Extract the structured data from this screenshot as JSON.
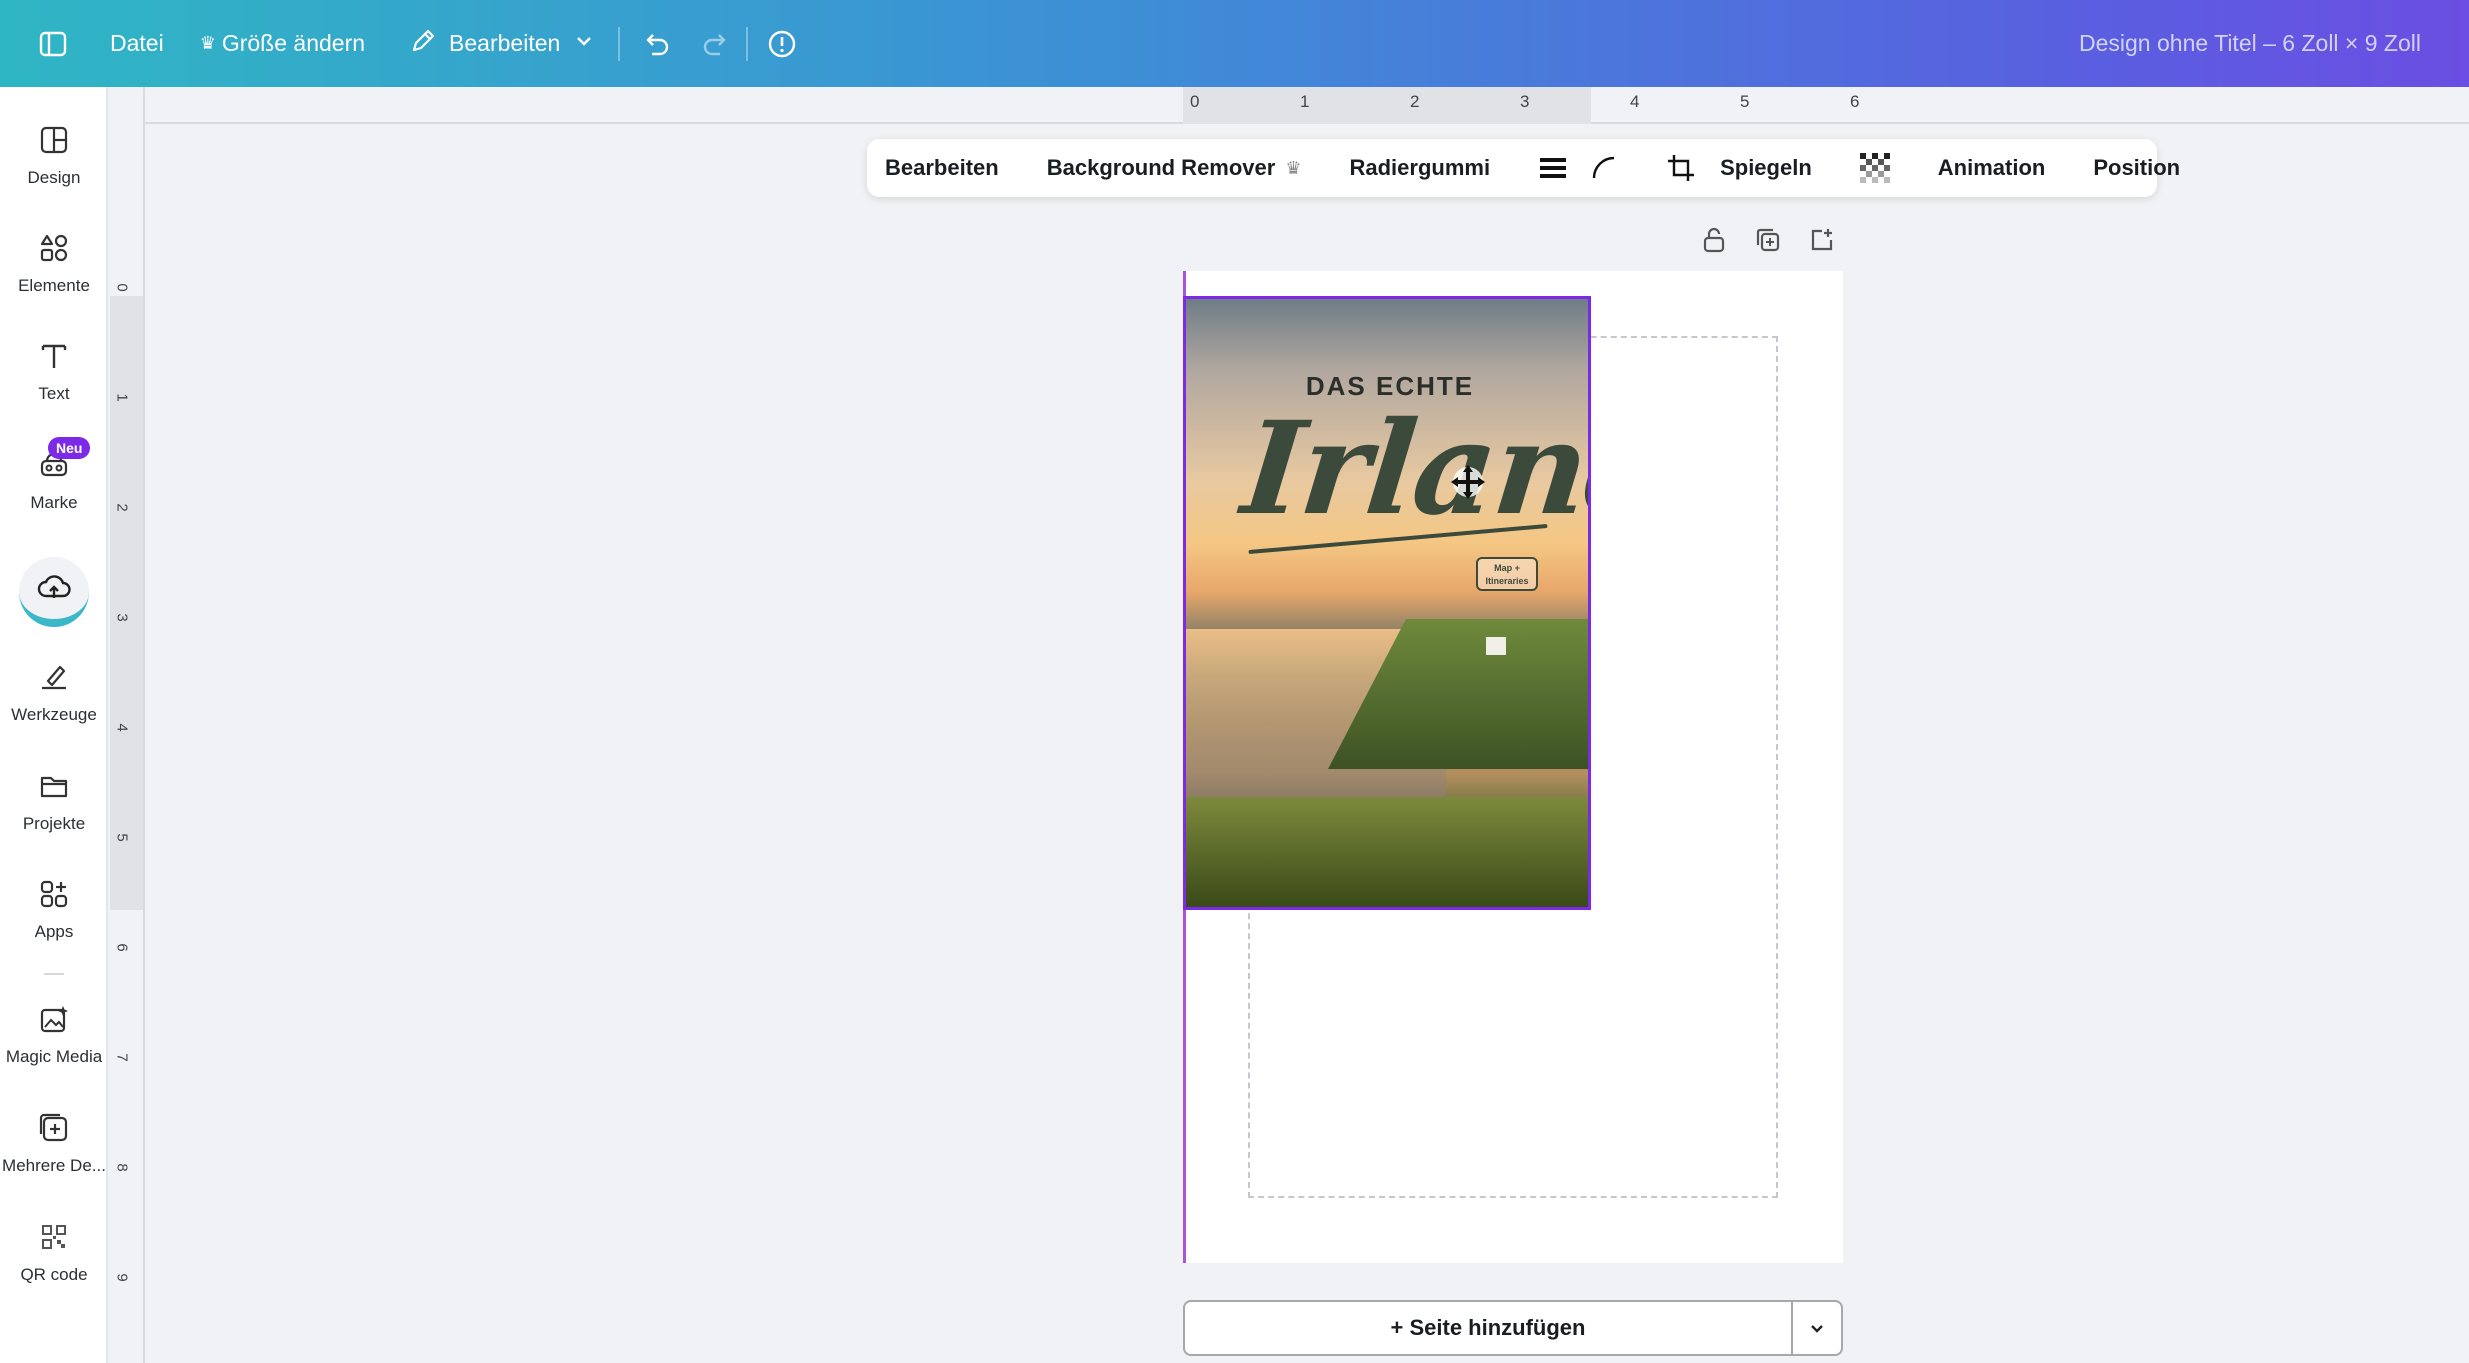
{
  "topbar": {
    "file": "Datei",
    "resize": "Größe ändern",
    "edit": "Bearbeiten",
    "doc_title": "Design ohne Titel – 6 Zoll × 9 Zoll"
  },
  "sidebar": {
    "items": [
      {
        "label": "Design",
        "icon": "layout-icon"
      },
      {
        "label": "Elemente",
        "icon": "shapes-icon"
      },
      {
        "label": "Text",
        "icon": "text-icon"
      },
      {
        "label": "Marke",
        "icon": "brand-icon",
        "badge": "Neu"
      },
      {
        "label": "",
        "icon": "upload-cloud-icon"
      },
      {
        "label": "Werkzeuge",
        "icon": "draw-icon"
      },
      {
        "label": "Projekte",
        "icon": "folder-icon"
      },
      {
        "label": "Apps",
        "icon": "apps-icon"
      },
      {
        "label": "Magic Media",
        "icon": "magic-media-icon"
      },
      {
        "label": "Mehrere De...",
        "icon": "multi-design-icon"
      },
      {
        "label": "QR code",
        "icon": "qr-code-icon"
      }
    ]
  },
  "ruler": {
    "top": [
      "0",
      "1",
      "2",
      "3",
      "4",
      "5",
      "6"
    ],
    "left": [
      "0",
      "1",
      "2",
      "3",
      "4",
      "5",
      "6",
      "7",
      "8",
      "9"
    ]
  },
  "context_toolbar": {
    "edit": "Bearbeiten",
    "bg_remover": "Background Remover",
    "eraser": "Radiergummi",
    "flip": "Spiegeln",
    "animation": "Animation",
    "position": "Position"
  },
  "cover": {
    "subtitle": "DAS ECHTE",
    "title": "Irland",
    "tag": "Map + Itineraries"
  },
  "add_page": "+ Seite hinzufügen",
  "colors": {
    "accent": "#7d2ae8",
    "topbar_start": "#2fb6c4",
    "topbar_end": "#6b4ee3"
  }
}
